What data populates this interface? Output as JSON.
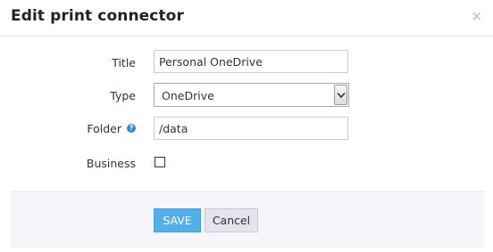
{
  "dialog": {
    "title": "Edit print connector",
    "close_glyph": "×"
  },
  "form": {
    "title_label": "Title",
    "title_value": "Personal OneDrive",
    "type_label": "Type",
    "type_value": "OneDrive",
    "folder_label": "Folder",
    "folder_help_glyph": "?",
    "folder_value": "/data",
    "business_label": "Business",
    "business_checked": false
  },
  "footer": {
    "save_label": "SAVE",
    "cancel_label": "Cancel"
  },
  "colors": {
    "accent": "#56aee7",
    "help_icon": "#2b8ccf",
    "footer_bg": "#f5f5fa"
  },
  "icons": {
    "close": "close-icon",
    "help": "help-icon",
    "dropdown": "chevron-down-icon"
  }
}
